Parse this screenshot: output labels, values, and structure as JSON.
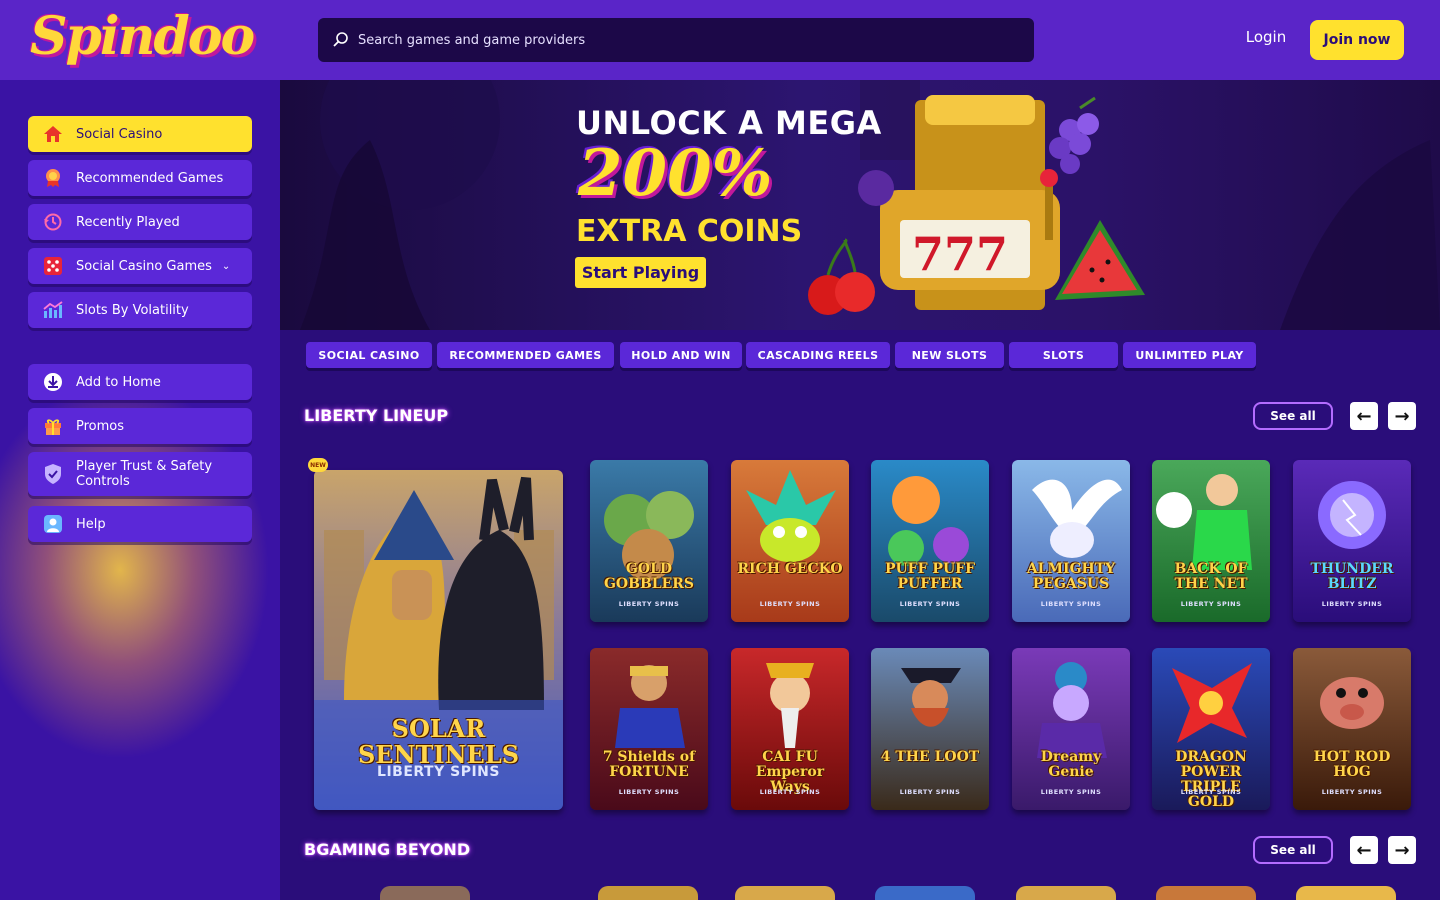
{
  "header": {
    "logo": "Spindoo",
    "search_placeholder": "Search games and game providers",
    "login_label": "Login",
    "join_label": "Join now"
  },
  "sidebar": {
    "items": [
      {
        "label": "Social Casino",
        "icon": "home-icon",
        "active": true
      },
      {
        "label": "Recommended Games",
        "icon": "badge-icon"
      },
      {
        "label": "Recently Played",
        "icon": "history-icon"
      },
      {
        "label": "Social Casino Games",
        "icon": "dice-icon",
        "has_dropdown": true
      },
      {
        "label": "Slots By Volatility",
        "icon": "chart-icon"
      },
      {
        "label": "Add to Home",
        "icon": "download-icon"
      },
      {
        "label": "Promos",
        "icon": "gift-icon"
      },
      {
        "label": "Player Trust & Safety Controls",
        "icon": "shield-icon"
      },
      {
        "label": "Help",
        "icon": "help-icon"
      }
    ]
  },
  "banner": {
    "line1": "UNLOCK A MEGA",
    "line2": "200%",
    "line3": "EXTRA COINS",
    "button": "Start Playing"
  },
  "tabs": [
    "SOCIAL CASINO",
    "RECOMMENDED GAMES",
    "HOLD AND WIN",
    "CASCADING REELS",
    "NEW SLOTS",
    "SLOTS",
    "UNLIMITED PLAY"
  ],
  "sections": [
    {
      "title": "LIBERTY LINEUP",
      "see_all": "See all",
      "featured": {
        "title": "SOLAR SENTINELS",
        "provider": "LIBERTY SPINS",
        "badge": "NEW"
      },
      "games": [
        {
          "title": "GOLD GOBBLERS",
          "provider": "LIBERTY SPINS"
        },
        {
          "title": "RICH GECKO",
          "provider": "LIBERTY SPINS"
        },
        {
          "title": "PUFF PUFF PUFFER",
          "provider": "LIBERTY SPINS"
        },
        {
          "title": "ALMIGHTY PEGASUS",
          "provider": "LIBERTY SPINS"
        },
        {
          "title": "BACK OF THE NET",
          "provider": "LIBERTY SPINS"
        },
        {
          "title": "THUNDER BLITZ",
          "provider": "LIBERTY SPINS"
        },
        {
          "title": "7 Shields of FORTUNE",
          "provider": "LIBERTY SPINS"
        },
        {
          "title": "CAI FU Emperor Ways",
          "provider": "LIBERTY SPINS"
        },
        {
          "title": "4 THE LOOT",
          "provider": "LIBERTY SPINS"
        },
        {
          "title": "Dreamy Genie",
          "provider": "LIBERTY SPINS"
        },
        {
          "title": "DRAGON POWER TRIPLE GOLD",
          "provider": "LIBERTY SPINS"
        },
        {
          "title": "HOT ROD HOG",
          "provider": "LIBERTY SPINS"
        }
      ]
    },
    {
      "title": "BGAMING BEYOND",
      "see_all": "See all"
    }
  ],
  "colors": {
    "header_bg": "#5a25c8",
    "sidebar_bg": "#3a13a4",
    "main_bg": "#2a0d7a",
    "accent_yellow": "#ffe12e",
    "nav_purple": "#5b28d8"
  }
}
